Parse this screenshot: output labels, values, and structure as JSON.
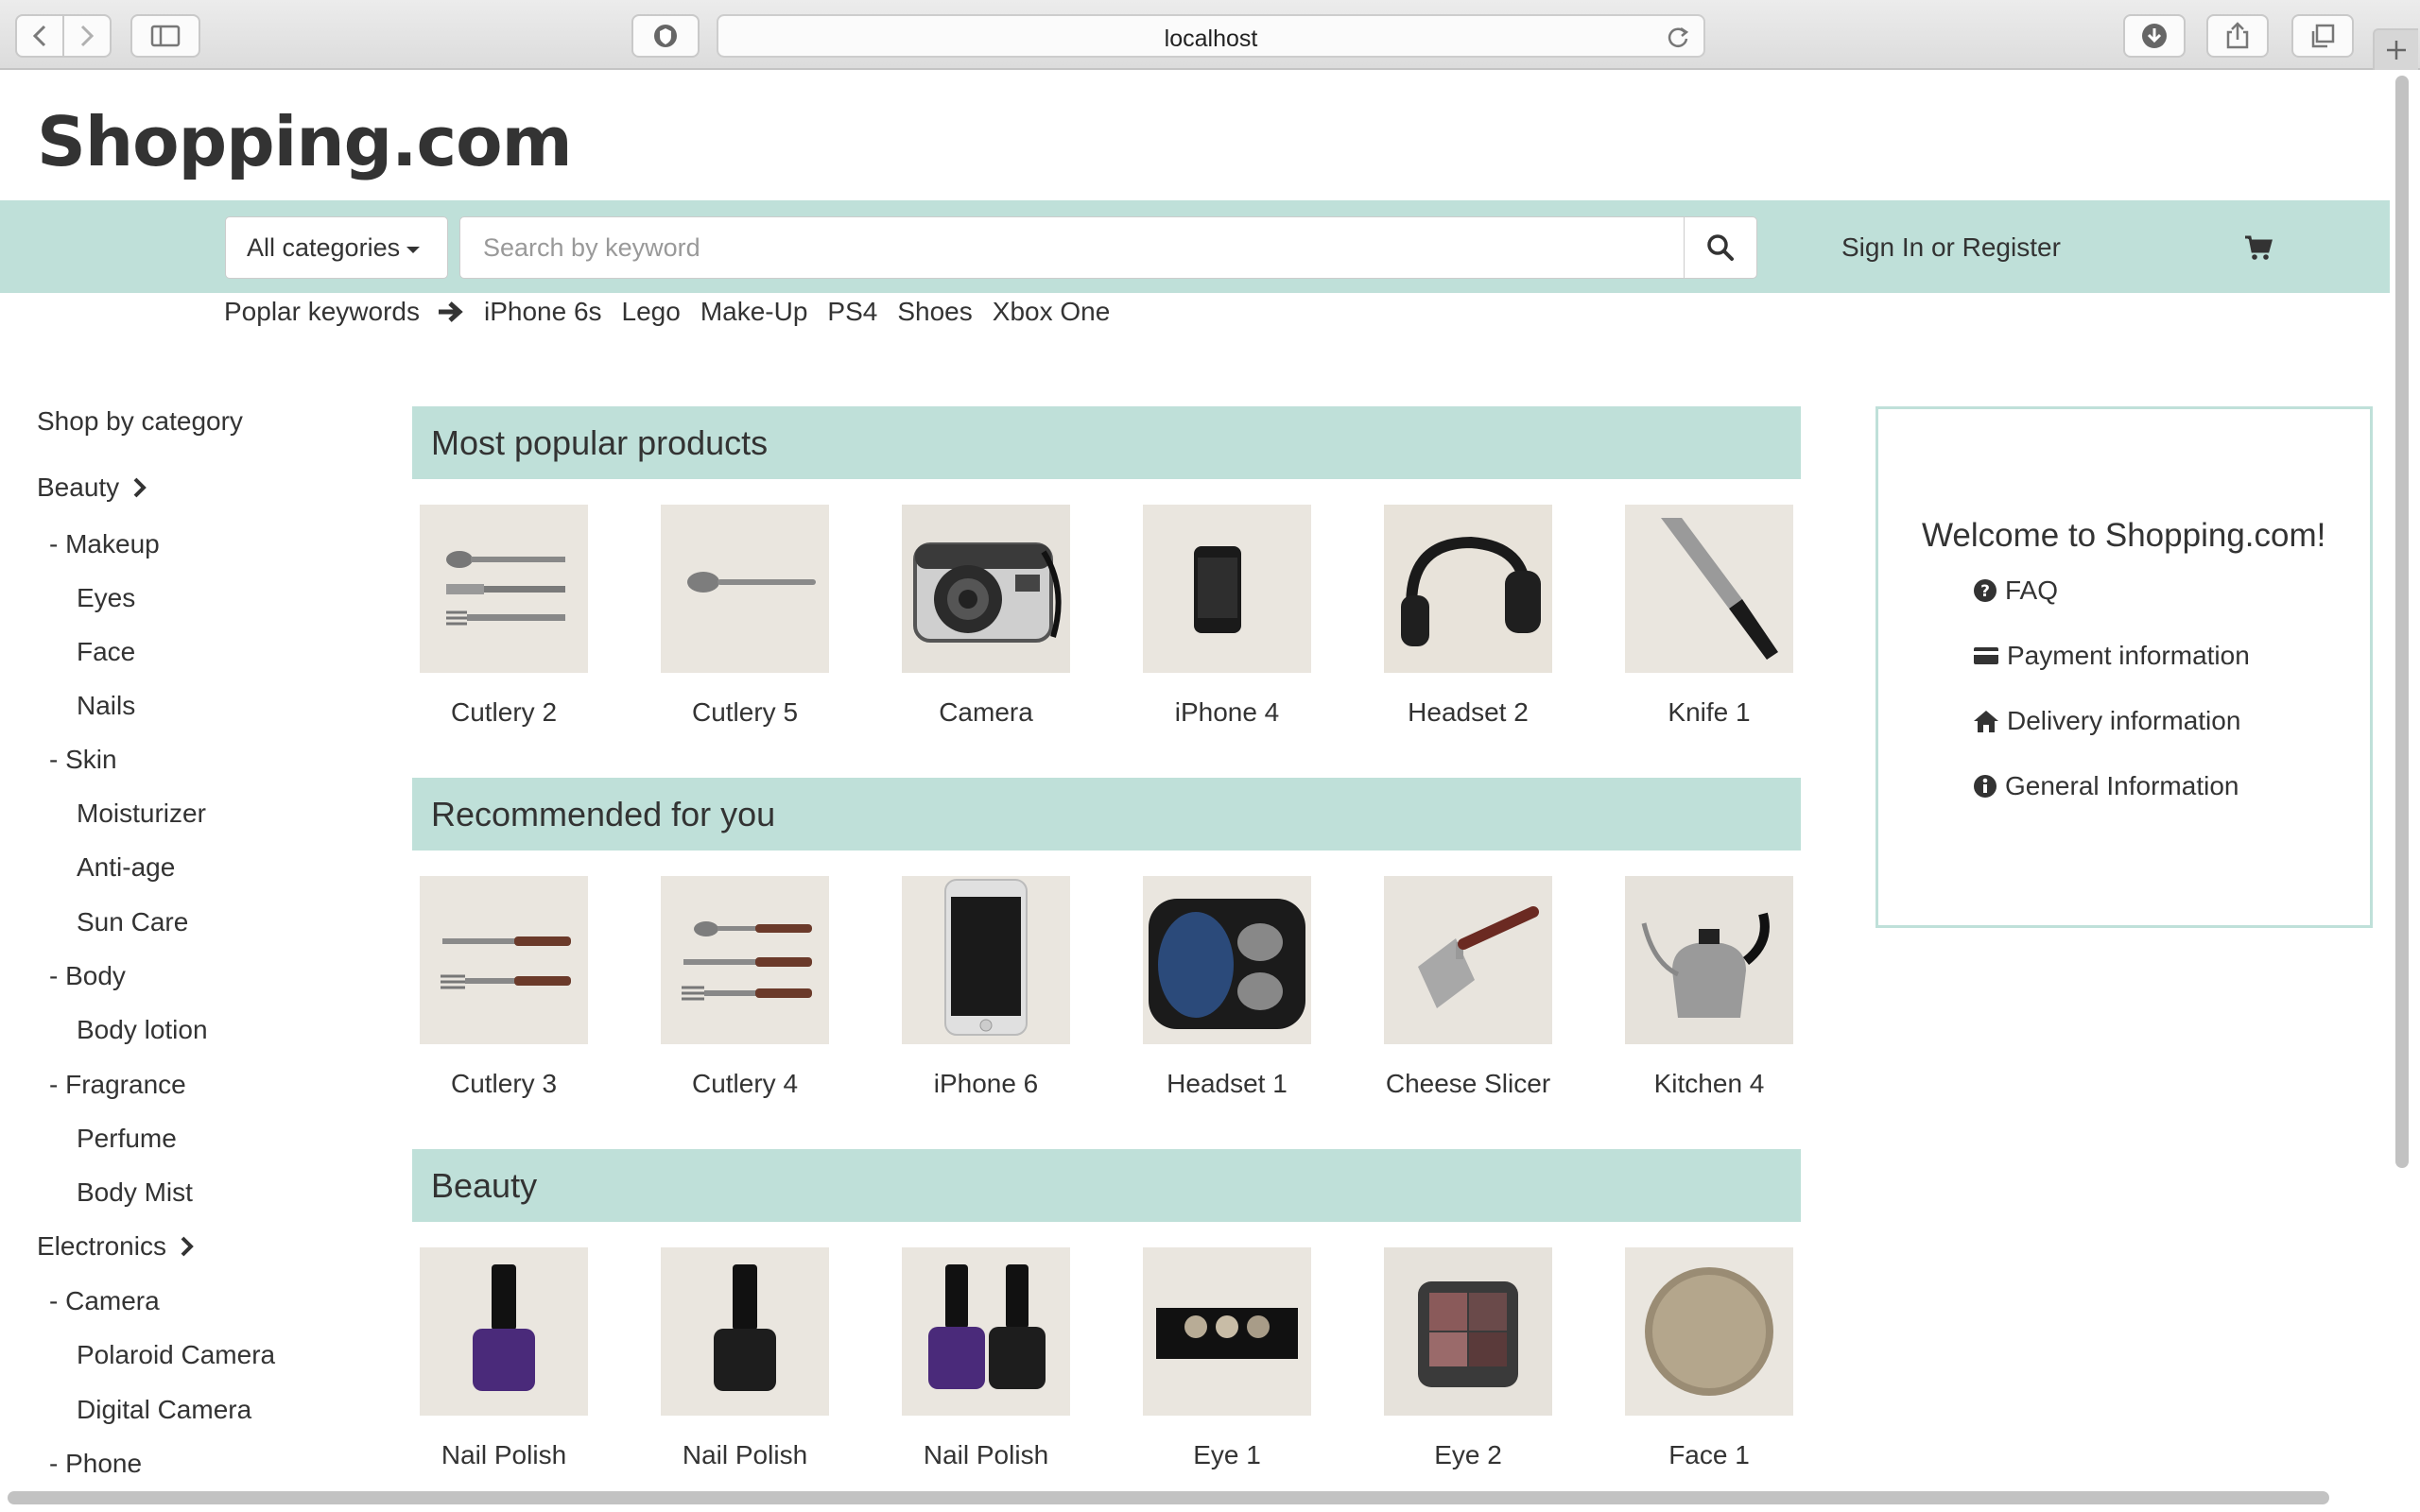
{
  "browser": {
    "url": "localhost"
  },
  "site": {
    "logo": "Shopping.com"
  },
  "search": {
    "category_label": "All categories",
    "placeholder": "Search by keyword",
    "value": ""
  },
  "header": {
    "signin_label": "Sign In or Register"
  },
  "keywords": {
    "label": "Poplar keywords",
    "items": [
      "iPhone 6s",
      "Lego",
      "Make-Up",
      "PS4",
      "Shoes",
      "Xbox One"
    ]
  },
  "sidebar": {
    "title": "Shop by category",
    "items": [
      {
        "label": "Beauty",
        "level": 0
      },
      {
        "label": "- Makeup",
        "level": 1
      },
      {
        "label": "Eyes",
        "level": 2
      },
      {
        "label": "Face",
        "level": 2
      },
      {
        "label": "Nails",
        "level": 2
      },
      {
        "label": "- Skin",
        "level": 1
      },
      {
        "label": "Moisturizer",
        "level": 2
      },
      {
        "label": "Anti-age",
        "level": 2
      },
      {
        "label": "Sun Care",
        "level": 2
      },
      {
        "label": "- Body",
        "level": 1
      },
      {
        "label": "Body lotion",
        "level": 2
      },
      {
        "label": "- Fragrance",
        "level": 1
      },
      {
        "label": "Perfume",
        "level": 2
      },
      {
        "label": "Body Mist",
        "level": 2
      },
      {
        "label": "Electronics",
        "level": 0
      },
      {
        "label": "- Camera",
        "level": 1
      },
      {
        "label": "Polaroid Camera",
        "level": 2
      },
      {
        "label": "Digital Camera",
        "level": 2
      },
      {
        "label": "- Phone",
        "level": 1
      }
    ]
  },
  "sections": [
    {
      "title": "Most popular products",
      "products": [
        {
          "name": "Cutlery 2",
          "image": "cutlery-set"
        },
        {
          "name": "Cutlery 5",
          "image": "spoon"
        },
        {
          "name": "Camera",
          "image": "camera"
        },
        {
          "name": "iPhone 4",
          "image": "iphone-small"
        },
        {
          "name": "Headset 2",
          "image": "headphones"
        },
        {
          "name": "Knife 1",
          "image": "knife"
        }
      ]
    },
    {
      "title": "Recommended for you",
      "products": [
        {
          "name": "Cutlery 3",
          "image": "knife-fork"
        },
        {
          "name": "Cutlery 4",
          "image": "cutlery-set-wood"
        },
        {
          "name": "iPhone 6",
          "image": "iphone-large"
        },
        {
          "name": "Headset 1",
          "image": "earbuds-case"
        },
        {
          "name": "Cheese Slicer",
          "image": "cheese-slicer"
        },
        {
          "name": "Kitchen 4",
          "image": "kettle"
        }
      ]
    },
    {
      "title": "Beauty",
      "products": [
        {
          "name": "Nail Polish",
          "image": "nail-polish-purple"
        },
        {
          "name": "Nail Polish",
          "image": "nail-polish-black"
        },
        {
          "name": "Nail Polish",
          "image": "nail-polish-pair"
        },
        {
          "name": "Eye 1",
          "image": "eyeshadow-palette"
        },
        {
          "name": "Eye 2",
          "image": "eyeshadow-compact"
        },
        {
          "name": "Face 1",
          "image": "face-powder"
        }
      ]
    }
  ],
  "welcome": {
    "title": "Welcome to Shopping.com!",
    "links": [
      {
        "label": "FAQ",
        "icon": "question-circle-icon"
      },
      {
        "label": "Payment information",
        "icon": "credit-card-icon"
      },
      {
        "label": "Delivery information",
        "icon": "home-icon"
      },
      {
        "label": "General Information",
        "icon": "info-circle-icon"
      }
    ]
  },
  "colors": {
    "accent": "#bfe0d9",
    "text": "#333333"
  }
}
